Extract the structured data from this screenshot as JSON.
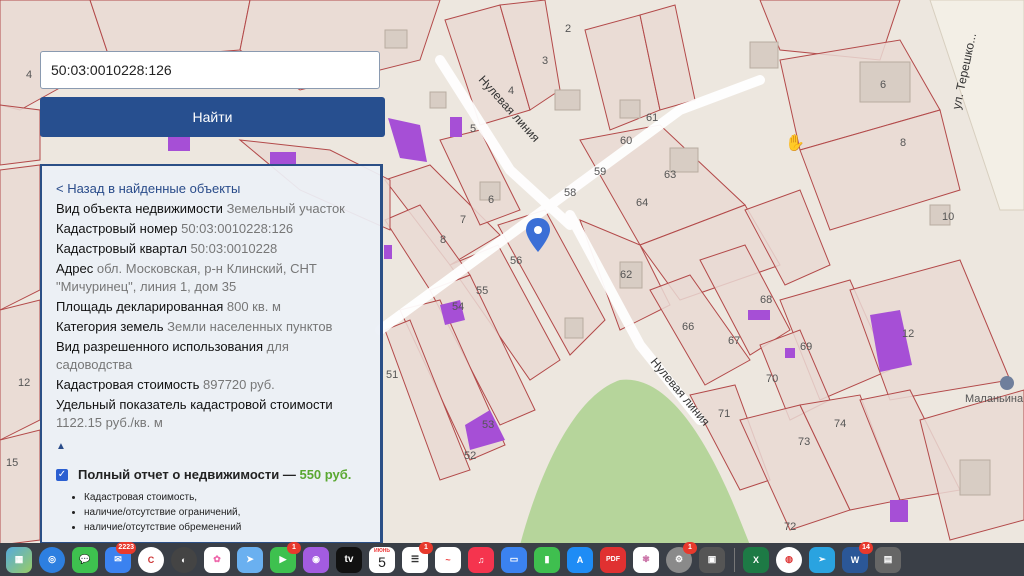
{
  "search": {
    "value": "50:03:0010228:126",
    "button_label": "Найти"
  },
  "panel": {
    "back_link": "< Назад в найденные объекты",
    "fields": [
      {
        "label": "Вид объекта недвижимости",
        "value": "Земельный участок"
      },
      {
        "label": "Кадастровый номер",
        "value": "50:03:0010228:126"
      },
      {
        "label": "Кадастровый квартал",
        "value": "50:03:0010228"
      },
      {
        "label": "Адрес",
        "value": "обл. Московская, р-н Клинский, СНТ \"Мичуринец\", линия 1, дом 35"
      },
      {
        "label": "Площадь декларированная",
        "value": "800 кв. м"
      },
      {
        "label": "Категория земель",
        "value": "Земли населенных пунктов"
      },
      {
        "label": "Вид разрешенного использования",
        "value": "для садоводства"
      },
      {
        "label": "Кадастровая стоимость",
        "value": "897720 руб."
      },
      {
        "label": "Удельный показатель кадастровой стоимости",
        "value": "1122.15 руб./кв. м"
      }
    ],
    "collapse_toggle": "▲",
    "report": {
      "checked": true,
      "title": "Полный отчет о недвижимости —",
      "price": "550 руб.",
      "features": [
        "Кадастровая стоимость,",
        "наличие/отсутствие ограничений,",
        "наличие/отсутствие обременений"
      ]
    }
  },
  "map": {
    "streets": {
      "nulevaya_1": "Нулевая линия",
      "nulevaya_2": "Нулевая линия",
      "tereshkova": "ул. Терешко..."
    },
    "poi": "Маланьина",
    "parcel_numbers": {
      "n2": "2",
      "n3": "3",
      "n4": "4",
      "n4b": "4",
      "n5": "5",
      "n6": "6",
      "n6b": "6",
      "n7": "7",
      "n8": "8",
      "n8b": "8",
      "n10": "10",
      "n12": "12",
      "n12b": "12",
      "n15": "15",
      "n51": "51",
      "n52": "52",
      "n53": "53",
      "n54": "54",
      "n55": "55",
      "n56": "56",
      "n58": "58",
      "n59": "59",
      "n60": "60",
      "n61": "61",
      "n62": "62",
      "n63": "63",
      "n64": "64",
      "n66": "66",
      "n67": "67",
      "n68": "68",
      "n69": "69",
      "n70": "70",
      "n71": "71",
      "n72": "72",
      "n73": "73",
      "n74": "74"
    },
    "colors": {
      "background": "#ede7df",
      "parcel_fill": "#e9d9d3",
      "parcel_border": "#b34a4a",
      "building": "#a64fd6",
      "park": "#b6d59b",
      "marker": "#3b6fd6"
    }
  },
  "dock": {
    "badges": {
      "mail": "2223",
      "messages": "1",
      "reminders": "1",
      "settings": "1",
      "word": "14"
    },
    "calendar_month": "ИЮНЬ",
    "calendar_day": "5",
    "tv_label": "tv"
  }
}
